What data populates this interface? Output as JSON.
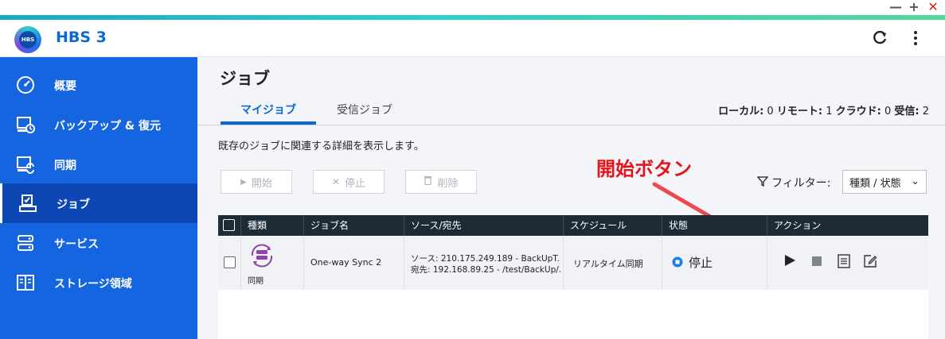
{
  "app": {
    "title": "HBS 3",
    "logo_text": "HBS"
  },
  "window": {
    "controls": [
      "—",
      "+",
      "✕"
    ]
  },
  "sidebar": {
    "items": [
      {
        "label": "概要",
        "icon": "gauge-icon",
        "active": false
      },
      {
        "label": "バックアップ & 復元",
        "icon": "backup-restore-icon",
        "active": false
      },
      {
        "label": "同期",
        "icon": "sync-icon",
        "active": false
      },
      {
        "label": "ジョブ",
        "icon": "job-icon",
        "active": true
      },
      {
        "label": "サービス",
        "icon": "service-icon",
        "active": false
      },
      {
        "label": "ストレージ領域",
        "icon": "storage-icon",
        "active": false
      }
    ]
  },
  "main": {
    "title": "ジョブ",
    "tabs": [
      {
        "label": "マイジョブ",
        "active": true
      },
      {
        "label": "受信ジョブ",
        "active": false
      }
    ],
    "counts": {
      "local_label": "ローカル:",
      "local_value": "0",
      "remote_label": "リモート:",
      "remote_value": "1",
      "cloud_label": "クラウド:",
      "cloud_value": "0",
      "received_label": "受信:",
      "received_value": "2"
    },
    "description": "既存のジョブに関連する詳細を表示します。",
    "toolbar": {
      "start_label": "開始",
      "stop_label": "停止",
      "delete_label": "削除"
    },
    "filter": {
      "label": "フィルター:",
      "selected": "種類 / 状態"
    },
    "annotation": "開始ボタン"
  },
  "table": {
    "headers": [
      "種類",
      "ジョブ名",
      "ソース/宛先",
      "スケジュール",
      "状態",
      "アクション"
    ],
    "rows": [
      {
        "type_label": "同期",
        "name": "One-way Sync 2",
        "source": "ソース: 210.175.249.189 - BackUpT...",
        "destination": "宛先: 192.168.89.25 - /test/BackUp/...",
        "schedule": "リアルタイム同期",
        "status": "停止"
      }
    ]
  },
  "colors": {
    "accent": "#0b69d1",
    "sidebar": "#1565e0",
    "sidebar_active": "#0c47b5",
    "annotation": "#e5141a",
    "table_header": "#1d2b36"
  }
}
